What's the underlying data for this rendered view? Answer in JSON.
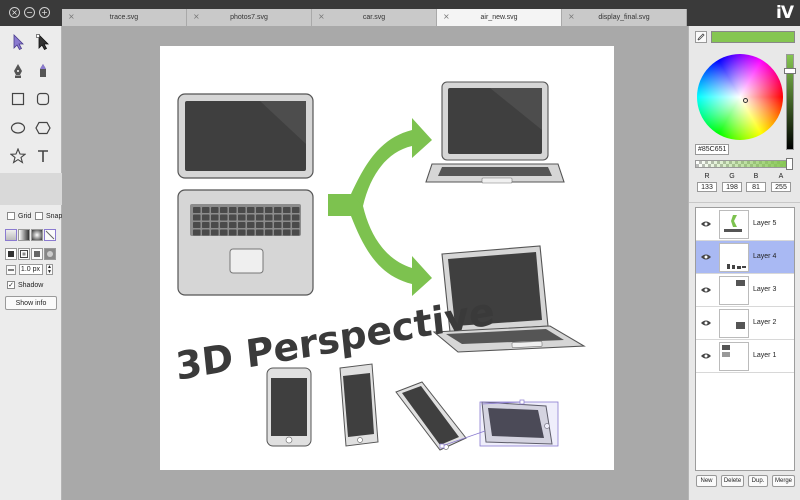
{
  "window": {
    "app_logo": "iV"
  },
  "tabs": [
    {
      "label": "trace.svg",
      "active": false
    },
    {
      "label": "photos7.svg",
      "active": false
    },
    {
      "label": "car.svg",
      "active": false
    },
    {
      "label": "air_new.svg",
      "active": true
    },
    {
      "label": "display_final.svg",
      "active": false
    }
  ],
  "toolbar": {
    "tools": [
      "select-tool",
      "direct-select-tool",
      "pen-tool",
      "pencil-tool",
      "rectangle-tool",
      "rounded-rectangle-tool",
      "ellipse-tool",
      "polygon-tool",
      "star-tool",
      "text-tool"
    ],
    "grid_label": "Grid",
    "snap_label": "Snap",
    "grid_checked": false,
    "snap_checked": false,
    "stroke_width": "1.0 px",
    "shadow_label": "Shadow",
    "shadow_checked": true,
    "show_info_label": "Show info"
  },
  "canvas": {
    "heading": "3D Perspective",
    "colors": {
      "arrow": "#7DC24F",
      "device_fill": "#d9d9d9",
      "screen": "#3f3f3f"
    }
  },
  "color_panel": {
    "hex": "#85C651",
    "r_label": "R",
    "g_label": "G",
    "b_label": "B",
    "a_label": "A",
    "r": "133",
    "g": "198",
    "b": "81",
    "a": "255",
    "current_color": "#85c651"
  },
  "layers": {
    "items": [
      {
        "name": "Layer 5",
        "selected": false
      },
      {
        "name": "Layer 4",
        "selected": true
      },
      {
        "name": "Layer 3",
        "selected": false
      },
      {
        "name": "Layer 2",
        "selected": false
      },
      {
        "name": "Layer 1",
        "selected": false
      }
    ],
    "buttons": {
      "new": "New",
      "delete": "Delete",
      "dup": "Dup.",
      "merge": "Merge"
    }
  }
}
